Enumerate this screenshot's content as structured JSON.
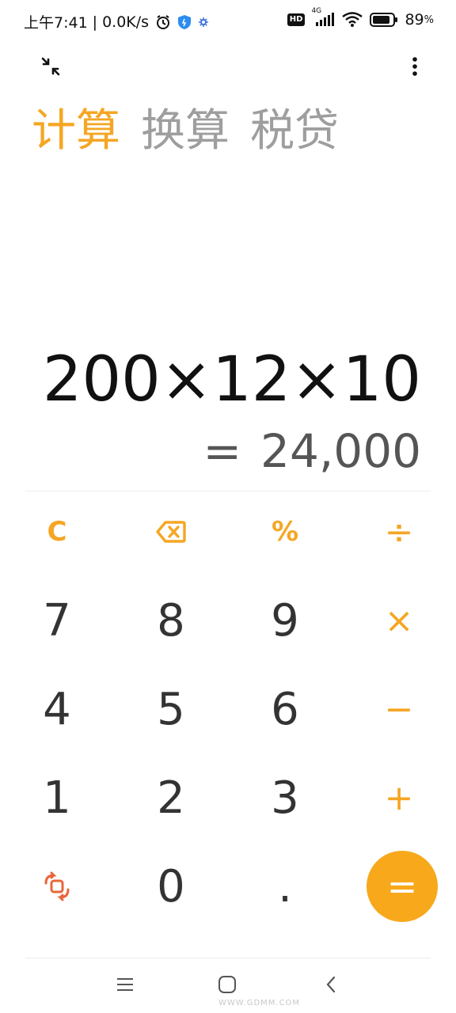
{
  "status_bar": {
    "time": "上午7:41",
    "separator": "|",
    "network_speed": "0.0K/s",
    "network_type": "4G",
    "hd_label": "HD",
    "battery_percent": "89",
    "battery_suffix": "%",
    "battery_level": 0.89,
    "icons": [
      "alarm-icon",
      "shield-icon",
      "gear-icon",
      "hd-icon",
      "signal-icon",
      "wifi-icon",
      "battery-icon"
    ]
  },
  "toolbar": {
    "collapse_icon": "collapse-arrows-icon",
    "menu_icon": "more-vertical-icon"
  },
  "tabs": [
    {
      "label": "计算",
      "active": true
    },
    {
      "label": "换算",
      "active": false
    },
    {
      "label": "税贷",
      "active": false
    }
  ],
  "display": {
    "expression": "200×12×10",
    "equals_sign": "=",
    "result": "24,000"
  },
  "keypad": {
    "rows": [
      [
        {
          "label": "C",
          "type": "fn",
          "name": "clear-button"
        },
        {
          "label": "",
          "type": "fn",
          "name": "backspace-button",
          "icon": "backspace-icon"
        },
        {
          "label": "%",
          "type": "fn",
          "name": "percent-button"
        },
        {
          "label": "÷",
          "type": "op",
          "name": "divide-button"
        }
      ],
      [
        {
          "label": "7",
          "type": "num",
          "name": "digit-7-button"
        },
        {
          "label": "8",
          "type": "num",
          "name": "digit-8-button"
        },
        {
          "label": "9",
          "type": "num",
          "name": "digit-9-button"
        },
        {
          "label": "×",
          "type": "op",
          "name": "multiply-button"
        }
      ],
      [
        {
          "label": "4",
          "type": "num",
          "name": "digit-4-button"
        },
        {
          "label": "5",
          "type": "num",
          "name": "digit-5-button"
        },
        {
          "label": "6",
          "type": "num",
          "name": "digit-6-button"
        },
        {
          "label": "−",
          "type": "op",
          "name": "subtract-button"
        }
      ],
      [
        {
          "label": "1",
          "type": "num",
          "name": "digit-1-button"
        },
        {
          "label": "2",
          "type": "num",
          "name": "digit-2-button"
        },
        {
          "label": "3",
          "type": "num",
          "name": "digit-3-button"
        },
        {
          "label": "+",
          "type": "op",
          "name": "add-button"
        }
      ],
      [
        {
          "label": "",
          "type": "fn",
          "name": "switch-mode-button",
          "icon": "swap-mode-icon"
        },
        {
          "label": "0",
          "type": "num",
          "name": "digit-0-button"
        },
        {
          "label": ".",
          "type": "num",
          "name": "decimal-button"
        },
        {
          "label": "=",
          "type": "equals",
          "name": "equals-button"
        }
      ]
    ]
  },
  "colors": {
    "accent": "#f5a623",
    "equals_bg": "#f7a81b",
    "inactive_tab": "#9e9e9e",
    "digit": "#333333",
    "mode_icon": "#e8663a"
  },
  "nav_bar": {
    "menu_icon": "recent-apps-icon",
    "home_icon": "home-icon",
    "back_icon": "back-icon"
  },
  "watermark": "WWW.GDMM.COM"
}
